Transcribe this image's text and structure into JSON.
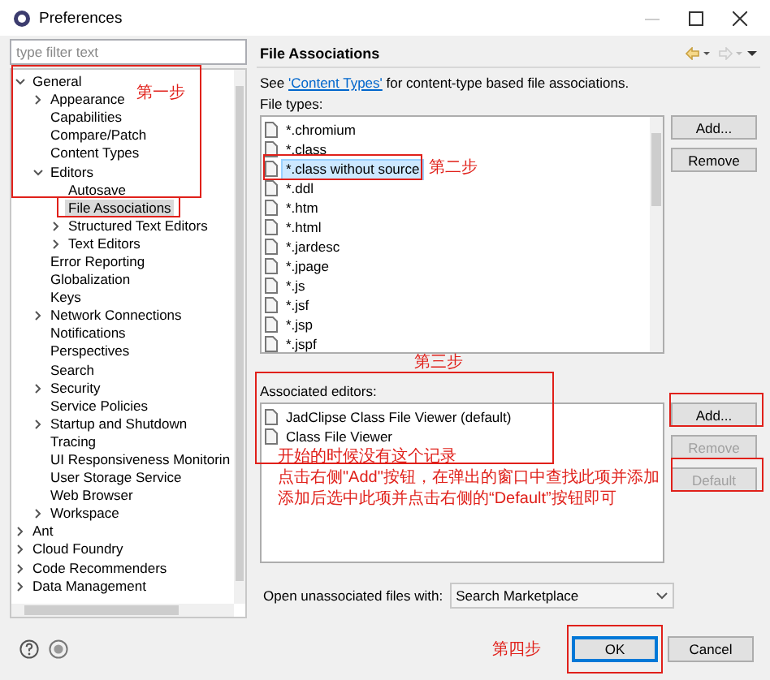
{
  "window": {
    "title": "Preferences"
  },
  "filter": {
    "placeholder": "type filter text"
  },
  "tree": [
    {
      "label": "General",
      "expanded": true,
      "selected": false,
      "children": [
        {
          "label": "Appearance",
          "expanded": false,
          "selected": false
        },
        {
          "label": "Capabilities",
          "selected": false
        },
        {
          "label": "Compare/Patch",
          "selected": false
        },
        {
          "label": "Content Types",
          "selected": false
        },
        {
          "label": "Editors",
          "expanded": true,
          "selected": false,
          "children": [
            {
              "label": "Autosave",
              "selected": false
            },
            {
              "label": "File Associations",
              "selected": true
            },
            {
              "label": "Structured Text Editors",
              "expanded": false,
              "selected": false
            },
            {
              "label": "Text Editors",
              "expanded": false,
              "selected": false
            }
          ]
        },
        {
          "label": "Error Reporting",
          "selected": false
        },
        {
          "label": "Globalization",
          "selected": false
        },
        {
          "label": "Keys",
          "selected": false
        },
        {
          "label": "Network Connections",
          "expanded": false,
          "selected": false
        },
        {
          "label": "Notifications",
          "selected": false
        },
        {
          "label": "Perspectives",
          "selected": false
        },
        {
          "label": "Search",
          "selected": false
        },
        {
          "label": "Security",
          "expanded": false,
          "selected": false
        },
        {
          "label": "Service Policies",
          "selected": false
        },
        {
          "label": "Startup and Shutdown",
          "expanded": false,
          "selected": false
        },
        {
          "label": "Tracing",
          "selected": false
        },
        {
          "label": "UI Responsiveness Monitorin",
          "selected": false
        },
        {
          "label": "User Storage Service",
          "selected": false
        },
        {
          "label": "Web Browser",
          "selected": false
        },
        {
          "label": "Workspace",
          "expanded": false,
          "selected": false
        }
      ]
    },
    {
      "label": "Ant",
      "expanded": false,
      "selected": false
    },
    {
      "label": "Cloud Foundry",
      "expanded": false,
      "selected": false
    },
    {
      "label": "Code Recommenders",
      "expanded": false,
      "selected": false
    },
    {
      "label": "Data Management",
      "expanded": false,
      "selected": false
    }
  ],
  "page": {
    "title": "File Associations",
    "intro_before": "See ",
    "intro_link": "'Content Types'",
    "intro_after": " for content-type based file associations.",
    "file_types_label": "File types:",
    "file_types": [
      {
        "label": "*.chromium",
        "selected": false
      },
      {
        "label": "*.class",
        "selected": false
      },
      {
        "label": "*.class without source",
        "selected": true
      },
      {
        "label": "*.ddl",
        "selected": false
      },
      {
        "label": "*.htm",
        "selected": false
      },
      {
        "label": "*.html",
        "selected": false
      },
      {
        "label": "*.jardesc",
        "selected": false
      },
      {
        "label": "*.jpage",
        "selected": false
      },
      {
        "label": "*.js",
        "selected": false
      },
      {
        "label": "*.jsf",
        "selected": false
      },
      {
        "label": "*.jsp",
        "selected": false
      },
      {
        "label": "*.jspf",
        "selected": false
      }
    ],
    "file_type_buttons": [
      {
        "label": "Add...",
        "disabled": false
      },
      {
        "label": "Remove",
        "disabled": false
      }
    ],
    "editors_label": "Associated editors:",
    "editors": [
      {
        "label": "JadClipse Class File Viewer (default)"
      },
      {
        "label": "Class File Viewer"
      }
    ],
    "editor_buttons": [
      {
        "label": "Add...",
        "disabled": false
      },
      {
        "label": "Remove",
        "disabled": true
      },
      {
        "label": "Default",
        "disabled": true
      }
    ],
    "open_with": {
      "label": "Open unassociated files with:",
      "value": "Search Marketplace"
    }
  },
  "buttons": [
    {
      "label": "OK",
      "default": true
    },
    {
      "label": "Cancel",
      "default": false
    }
  ],
  "annotations": {
    "step1": "第一步",
    "step2": "第二步",
    "step3": "第三步",
    "step4": "第四步",
    "notes": [
      "开始的时候没有这个记录",
      "点击右侧\"Add\"按钮，在弹出的窗口中查找此项并添加",
      "添加后选中此项并点击右侧的“Default”按钮即可"
    ]
  }
}
